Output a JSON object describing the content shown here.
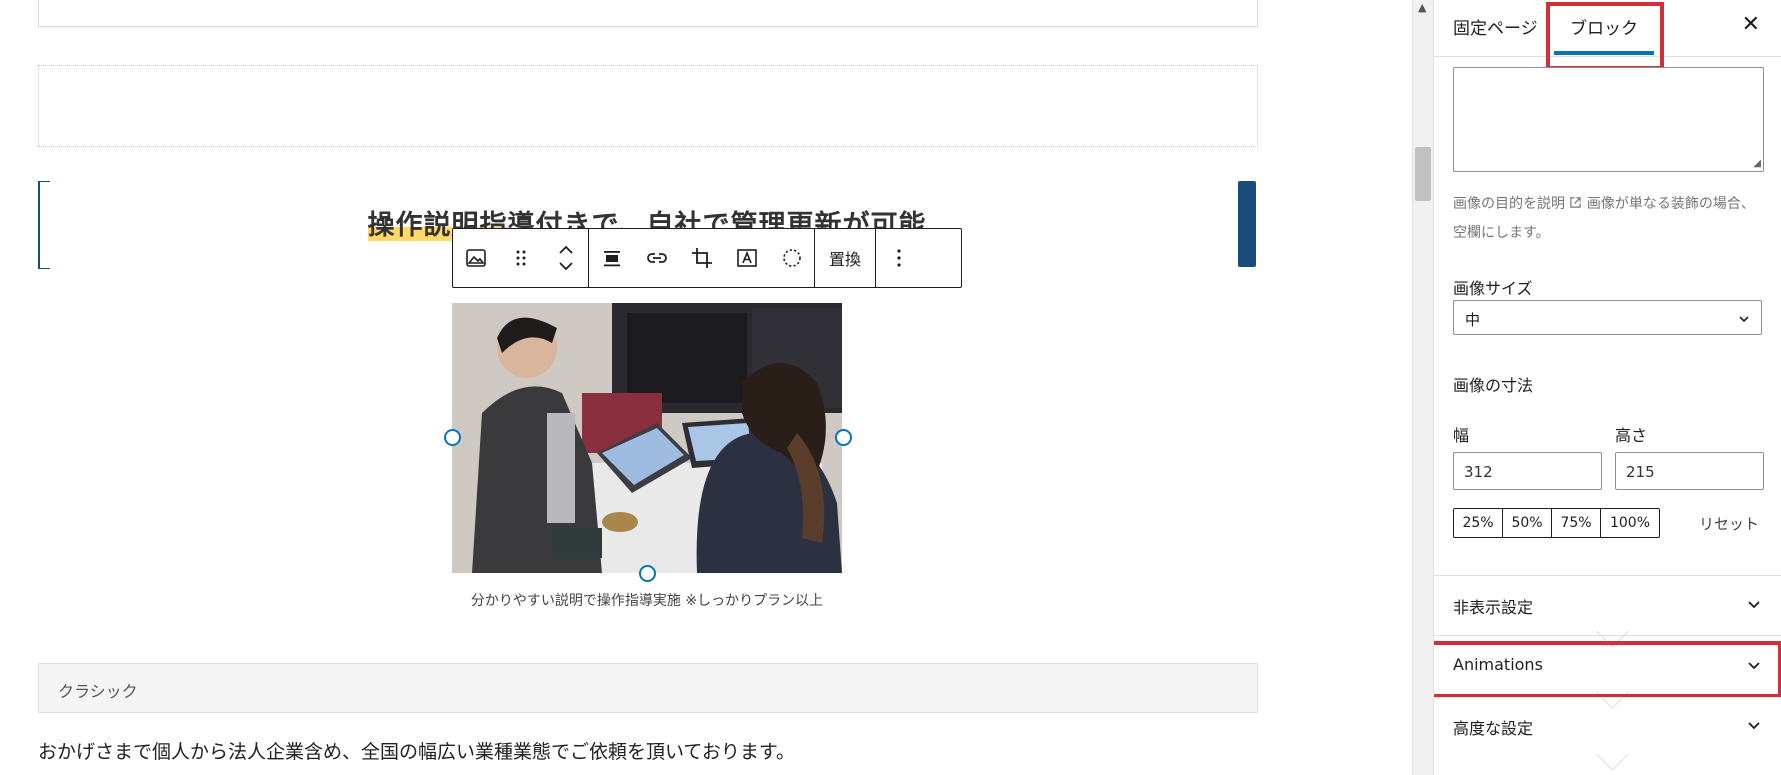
{
  "editor": {
    "heading": {
      "highlighted": "操作説明指",
      "rest": "導付きで、自社で管理更新が可能"
    },
    "toolbar": {
      "icons": [
        "image-icon",
        "drag-handle-icon",
        "move-up-down-icon",
        "align-icon",
        "link-icon",
        "crop-icon",
        "text-overlay-icon",
        "duotone-icon"
      ],
      "replace_label": "置換"
    },
    "caption": "分かりやすい説明で操作指導実施 ※しっかりプラン以上",
    "classic_label": "クラシック",
    "paragraph": "おかげさまで個人から法人企業含め、全国の幅広い業種業態でご依頼を頂いております。"
  },
  "sidebar": {
    "tabs": {
      "page": "固定ページ",
      "block": "ブロック"
    },
    "close_label": "✕",
    "alt_help_link": "画像の目的を説明",
    "alt_help_rest": "画像が単なる装飾の場合、空欄にします。",
    "image_size_label": "画像サイズ",
    "image_size_value": "中",
    "dimensions_label": "画像の寸法",
    "width_label": "幅",
    "height_label": "高さ",
    "width_value": "312",
    "height_value": "215",
    "percent_buttons": [
      "25%",
      "50%",
      "75%",
      "100%"
    ],
    "reset_label": "リセット",
    "panels": [
      "非表示設定",
      "Animations",
      "高度な設定"
    ]
  },
  "colors": {
    "accent": "#0a74b8",
    "highlight_box": "#d32f3a",
    "heading_bar": "#1a4b7a"
  }
}
